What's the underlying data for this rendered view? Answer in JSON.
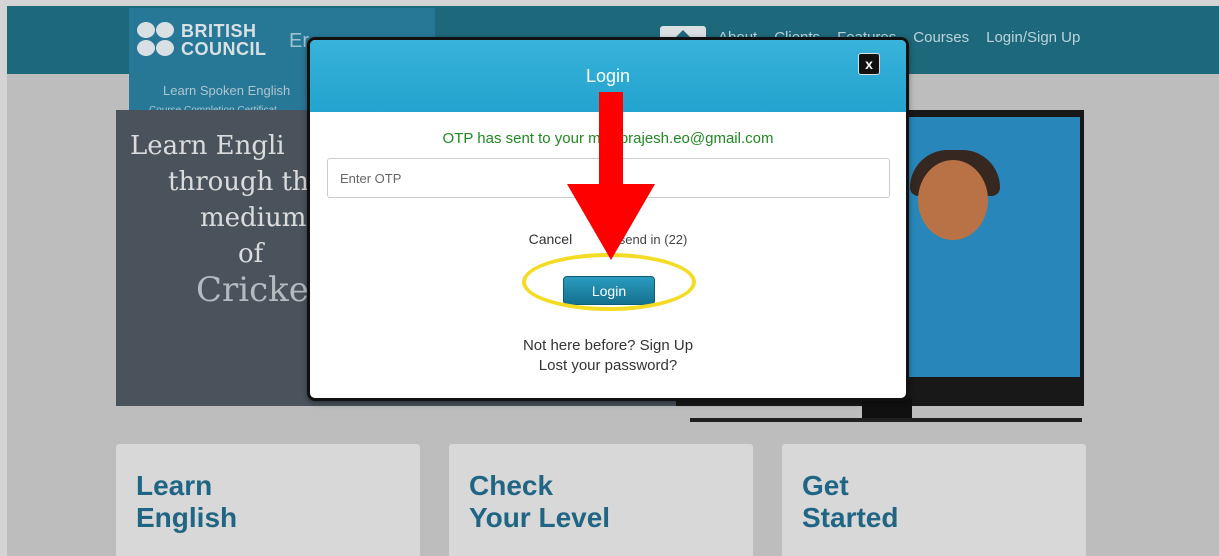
{
  "site": {
    "brand_name_line1": "BRITISH",
    "brand_name_line2": "COUNCIL",
    "brand_suffix": "Er",
    "brand_tagline": "Learn Spoken English",
    "brand_subtagline": "Course Completion Certificat",
    "nav": [
      "About",
      "Clients",
      "Features",
      "Courses",
      "Login/Sign Up"
    ],
    "hero_lines": [
      "Learn Engli",
      "through th",
      "medium",
      "of",
      "Cricket"
    ]
  },
  "cards": [
    {
      "title_line1": "Learn",
      "title_line2": "English"
    },
    {
      "title_line1": "Check",
      "title_line2": "Your Level"
    },
    {
      "title_line1": "Get",
      "title_line2": "Started"
    }
  ],
  "modal": {
    "title": "Login",
    "close_label": "x",
    "otp_message": "OTP has sent to your mail brajesh.eo@gmail.com",
    "otp_placeholder": "Enter OTP",
    "cancel_label": "Cancel",
    "resend_label": "Resend in (22)",
    "login_label": "Login",
    "signup_text": "Not here before? Sign Up",
    "lost_password_text": "Lost your password?"
  },
  "annotations": {
    "arrow_color": "#ff0000",
    "highlight_color": "#f4dc24"
  }
}
